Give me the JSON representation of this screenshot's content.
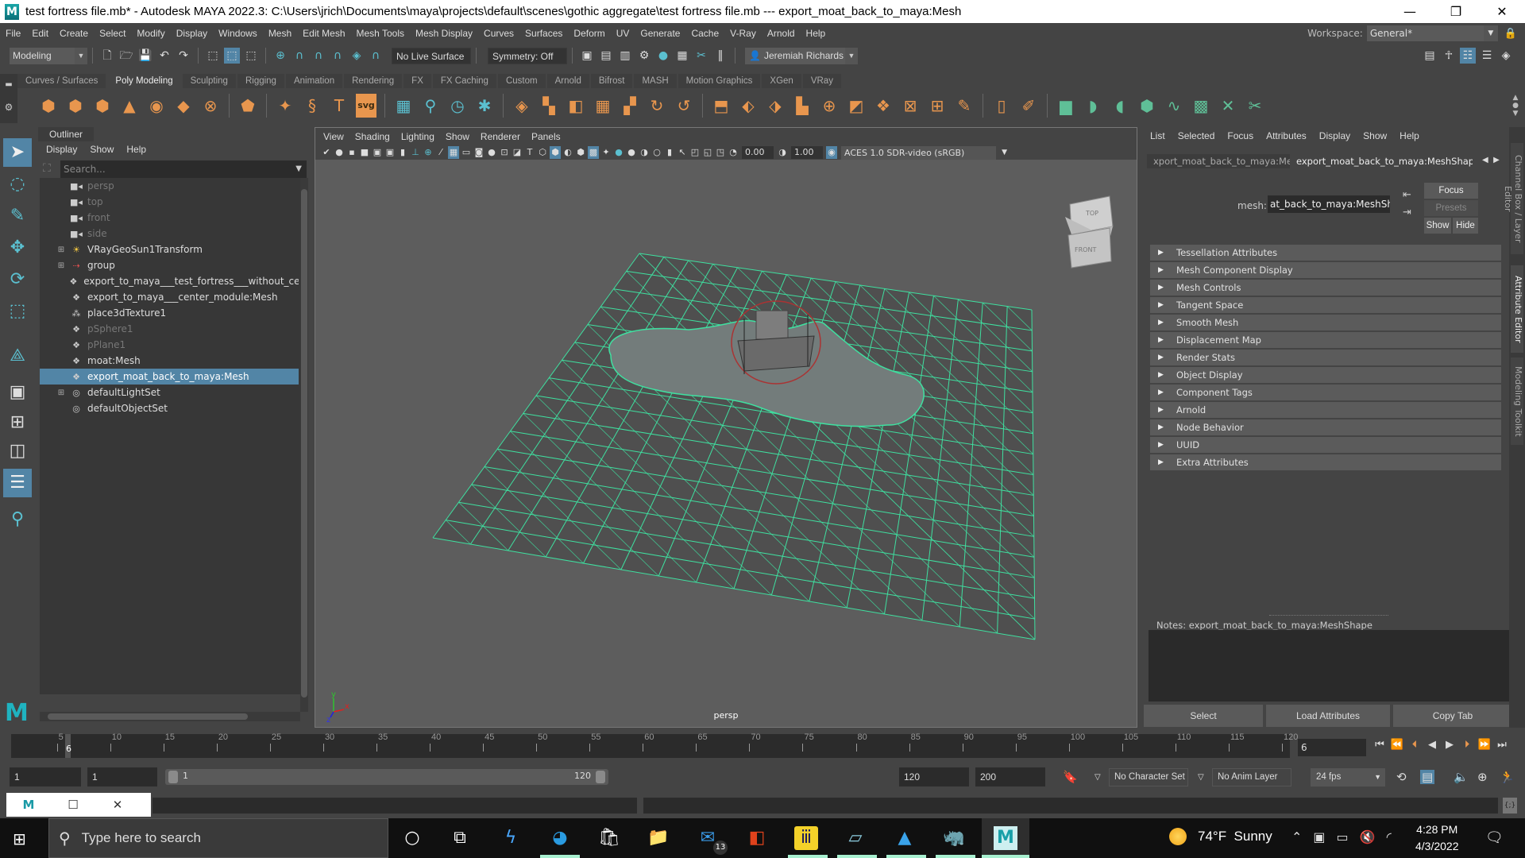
{
  "titlebar": {
    "title": "test fortress file.mb* - Autodesk MAYA 2022.3: C:\\Users\\jrich\\Documents\\maya\\projects\\default\\scenes\\gothic aggregate\\test fortress file.mb   ---   export_moat_back_to_maya:Mesh",
    "logo": "M",
    "minimize": "—",
    "restore": "❐",
    "close": "✕"
  },
  "menubar": {
    "items": [
      "File",
      "Edit",
      "Create",
      "Select",
      "Modify",
      "Display",
      "Windows",
      "Mesh",
      "Edit Mesh",
      "Mesh Tools",
      "Mesh Display",
      "Curves",
      "Surfaces",
      "Deform",
      "UV",
      "Generate",
      "Cache",
      "V-Ray",
      "Arnold",
      "Help"
    ],
    "workspace_label": "Workspace:",
    "workspace_value": "General*"
  },
  "statusline": {
    "menuset": "Modeling",
    "live_surface": "No Live Surface",
    "symmetry": "Symmetry: Off",
    "user": "Jeremiah Richards"
  },
  "shelf": {
    "tabs": [
      "Curves / Surfaces",
      "Poly Modeling",
      "Sculpting",
      "Rigging",
      "Animation",
      "Rendering",
      "FX",
      "FX Caching",
      "Custom",
      "Arnold",
      "Bifrost",
      "MASH",
      "Motion Graphics",
      "XGen",
      "VRay"
    ],
    "active_tab": "Poly Modeling",
    "icons": [
      {
        "name": "poly-sphere-icon",
        "glyph": "⬢",
        "color": "orange"
      },
      {
        "name": "poly-cube-icon",
        "glyph": "⬢",
        "color": "orange"
      },
      {
        "name": "poly-cylinder-icon",
        "glyph": "⬢",
        "color": "orange"
      },
      {
        "name": "poly-cone-icon",
        "glyph": "▲",
        "color": "orange"
      },
      {
        "name": "poly-torus-icon",
        "glyph": "◉",
        "color": "orange"
      },
      {
        "name": "poly-plane-icon",
        "glyph": "◆",
        "color": "orange"
      },
      {
        "name": "poly-disc-icon",
        "glyph": "⊗",
        "color": "orange"
      },
      {
        "name": "platonic-solid-icon",
        "glyph": "⬟",
        "color": "orange"
      },
      {
        "name": "super-shape-icon",
        "glyph": "✦",
        "color": "orange"
      },
      {
        "name": "sweep-mesh-icon",
        "glyph": "§",
        "color": "orange"
      },
      {
        "name": "poly-text-icon",
        "glyph": "T",
        "color": "orange"
      },
      {
        "name": "svg-icon",
        "glyph": "svg",
        "color": "orange"
      },
      {
        "name": "type-grid-icon",
        "glyph": "▦",
        "color": "teal"
      },
      {
        "name": "measure-icon",
        "glyph": "⚲",
        "color": "teal"
      },
      {
        "name": "pivot-icon",
        "glyph": "◷",
        "color": "teal"
      },
      {
        "name": "reset-transform-icon",
        "glyph": "✱",
        "color": "teal"
      },
      {
        "name": "combine-icon",
        "glyph": "◈",
        "color": "orange"
      },
      {
        "name": "separate-icon",
        "glyph": "▚",
        "color": "orange"
      },
      {
        "name": "mirror-icon",
        "glyph": "◧",
        "color": "orange"
      },
      {
        "name": "smooth-icon",
        "glyph": "▦",
        "color": "orange"
      },
      {
        "name": "reduce-icon",
        "glyph": "▞",
        "color": "orange"
      },
      {
        "name": "remesh-icon",
        "glyph": "↻",
        "color": "orange"
      },
      {
        "name": "retopo-icon",
        "glyph": "↺",
        "color": "orange"
      },
      {
        "name": "extrude-icon",
        "glyph": "⬒",
        "color": "orange"
      },
      {
        "name": "bridge-icon",
        "glyph": "⬖",
        "color": "orange"
      },
      {
        "name": "bevel-icon",
        "glyph": "⬗",
        "color": "orange"
      },
      {
        "name": "append-icon",
        "glyph": "▙",
        "color": "orange"
      },
      {
        "name": "circularize-icon",
        "glyph": "⊕",
        "color": "orange"
      },
      {
        "name": "wedge-icon",
        "glyph": "◩",
        "color": "orange"
      },
      {
        "name": "poke-icon",
        "glyph": "❖",
        "color": "orange"
      },
      {
        "name": "fill-hole-icon",
        "glyph": "⊠",
        "color": "orange"
      },
      {
        "name": "make-hole-icon",
        "glyph": "⊞",
        "color": "orange"
      },
      {
        "name": "multi-cut-icon",
        "glyph": "✎",
        "color": "orange"
      },
      {
        "name": "edge-loop-icon",
        "glyph": "▯",
        "color": "orange"
      },
      {
        "name": "quad-draw-icon",
        "glyph": "✐",
        "color": "orange"
      },
      {
        "name": "planar-uv-icon",
        "glyph": "▆",
        "color": "green"
      },
      {
        "name": "cylindrical-uv-icon",
        "glyph": "◗",
        "color": "green"
      },
      {
        "name": "spherical-uv-icon",
        "glyph": "◖",
        "color": "green"
      },
      {
        "name": "auto-uv-icon",
        "glyph": "⬢",
        "color": "green"
      },
      {
        "name": "contour-stretch-icon",
        "glyph": "∿",
        "color": "green"
      },
      {
        "name": "uv-editor-icon",
        "glyph": "▩",
        "color": "green"
      },
      {
        "name": "unfold-icon",
        "glyph": "✕",
        "color": "green"
      },
      {
        "name": "cut-sew-icon",
        "glyph": "✂",
        "color": "green"
      }
    ]
  },
  "toolbox": {
    "tools": [
      {
        "name": "select-tool-icon",
        "glyph": "➤",
        "active": true
      },
      {
        "name": "lasso-tool-icon",
        "glyph": "◌"
      },
      {
        "name": "paint-select-icon",
        "glyph": "✎"
      },
      {
        "name": "move-tool-icon",
        "glyph": "✥"
      },
      {
        "name": "rotate-tool-icon",
        "glyph": "⟳"
      },
      {
        "name": "scale-tool-icon",
        "glyph": "⬚"
      },
      {
        "name": "show-manipulator-icon",
        "glyph": "⟁"
      },
      {
        "name": "single-pane-layout-icon",
        "glyph": "▣"
      },
      {
        "name": "four-pane-layout-icon",
        "glyph": "⊞"
      },
      {
        "name": "two-pane-layout-icon",
        "glyph": "◫"
      },
      {
        "name": "outliner-layout-icon",
        "glyph": "☰",
        "active": true
      },
      {
        "name": "search-layout-icon",
        "glyph": "⚲"
      }
    ]
  },
  "outliner": {
    "title": "Outliner",
    "menu": [
      "Display",
      "Show",
      "Help"
    ],
    "search_placeholder": "Search...",
    "items": [
      {
        "label": "persp",
        "icon": "camera",
        "dim": true,
        "expandable": false
      },
      {
        "label": "top",
        "icon": "camera",
        "dim": true,
        "expandable": false
      },
      {
        "label": "front",
        "icon": "camera",
        "dim": true,
        "expandable": false
      },
      {
        "label": "side",
        "icon": "camera",
        "dim": true,
        "expandable": false
      },
      {
        "label": "VRayGeoSun1Transform",
        "icon": "sun",
        "dim": false,
        "expandable": true
      },
      {
        "label": "group",
        "icon": "group",
        "dim": false,
        "expandable": true
      },
      {
        "label": "export_to_maya___test_fortress___without_center_mo",
        "icon": "mesh",
        "dim": false,
        "expandable": false
      },
      {
        "label": "export_to_maya___center_module:Mesh",
        "icon": "mesh",
        "dim": false,
        "expandable": false
      },
      {
        "label": "place3dTexture1",
        "icon": "texture",
        "dim": false,
        "expandable": false
      },
      {
        "label": "pSphere1",
        "icon": "mesh",
        "dim": true,
        "expandable": false
      },
      {
        "label": "pPlane1",
        "icon": "mesh",
        "dim": true,
        "expandable": false
      },
      {
        "label": "moat:Mesh",
        "icon": "mesh",
        "dim": false,
        "expandable": false
      },
      {
        "label": "export_moat_back_to_maya:Mesh",
        "icon": "mesh",
        "dim": false,
        "expandable": false,
        "selected": true
      },
      {
        "label": "defaultLightSet",
        "icon": "set",
        "dim": false,
        "expandable": true
      },
      {
        "label": "defaultObjectSet",
        "icon": "set",
        "dim": false,
        "expandable": false
      }
    ]
  },
  "viewport": {
    "menu": [
      "View",
      "Shading",
      "Lighting",
      "Show",
      "Renderer",
      "Panels"
    ],
    "exposure": "0.00",
    "gamma": "1.00",
    "color_space": "ACES 1.0 SDR-video (sRGB)",
    "camera": "persp",
    "viewcube_top": "TOP",
    "viewcube_front": "FRONT",
    "axis_x": "x",
    "axis_y": "y",
    "axis_z": "z",
    "wire_color": "#3fe0a0"
  },
  "attribute_editor": {
    "menu": [
      "List",
      "Selected",
      "Focus",
      "Attributes",
      "Display",
      "Show",
      "Help"
    ],
    "tabs": [
      "xport_moat_back_to_maya:Mesh",
      "export_moat_back_to_maya:MeshShape"
    ],
    "active_tab": 1,
    "mesh_label": "mesh:",
    "mesh_value": "at_back_to_maya:MeshShape",
    "focus": "Focus",
    "presets": "Presets",
    "show": "Show",
    "hide": "Hide",
    "sections": [
      "Tessellation Attributes",
      "Mesh Component Display",
      "Mesh Controls",
      "Tangent Space",
      "Smooth Mesh",
      "Displacement Map",
      "Render Stats",
      "Object Display",
      "Component Tags",
      "Arnold",
      "Node Behavior",
      "UUID",
      "Extra Attributes"
    ],
    "notes_label": "Notes:  export_moat_back_to_maya:MeshShape",
    "buttons": [
      "Select",
      "Load Attributes",
      "Copy Tab"
    ]
  },
  "side_tabs": [
    "Channel Box / Layer Editor",
    "Attribute Editor",
    "Modeling Toolkit"
  ],
  "timeline": {
    "start": 1,
    "end": 120,
    "current_frame": "6",
    "ticks": [
      5,
      10,
      15,
      20,
      25,
      30,
      35,
      40,
      45,
      50,
      55,
      60,
      65,
      70,
      75,
      80,
      85,
      90,
      95,
      100,
      105,
      110,
      115,
      120
    ]
  },
  "range": {
    "start_field": "1",
    "anim_start_field": "1",
    "range_start": "1",
    "range_end": "120",
    "end_field": "120",
    "anim_end_field": "200",
    "character_set": "No Character Set",
    "anim_layer": "No Anim Layer",
    "fps": "24 fps"
  },
  "taskbar": {
    "search_placeholder": "Type here to search",
    "weather_temp": "74°F",
    "weather_desc": "Sunny",
    "time": "4:28 PM",
    "date": "4/3/2022",
    "mail_badge": "13"
  }
}
